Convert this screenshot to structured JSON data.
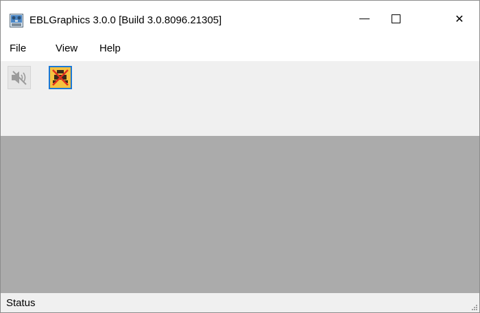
{
  "window": {
    "title": "EBLGraphics 3.0.0 [Build 3.0.8096.21305]",
    "app_icon": "app-icon",
    "controls": {
      "minimize_icon": "minimize-icon",
      "maximize_icon": "maximize-icon",
      "close_icon": "close-icon",
      "close_glyph": "✕"
    }
  },
  "menu": {
    "items": [
      {
        "label": "File"
      },
      {
        "label": "View"
      },
      {
        "label": "Help"
      }
    ]
  },
  "toolbar": {
    "buttons": [
      {
        "icon": "speaker-muted-icon",
        "state": "disabled"
      },
      {
        "icon": "disconnected-alert-icon",
        "state": "active"
      }
    ]
  },
  "colors": {
    "main_area": "#ababab",
    "toolbar_bg": "#f0f0f0",
    "alert_button": "#f5c13f",
    "focus_border": "#1a78d6"
  },
  "statusbar": {
    "text": "Status"
  }
}
